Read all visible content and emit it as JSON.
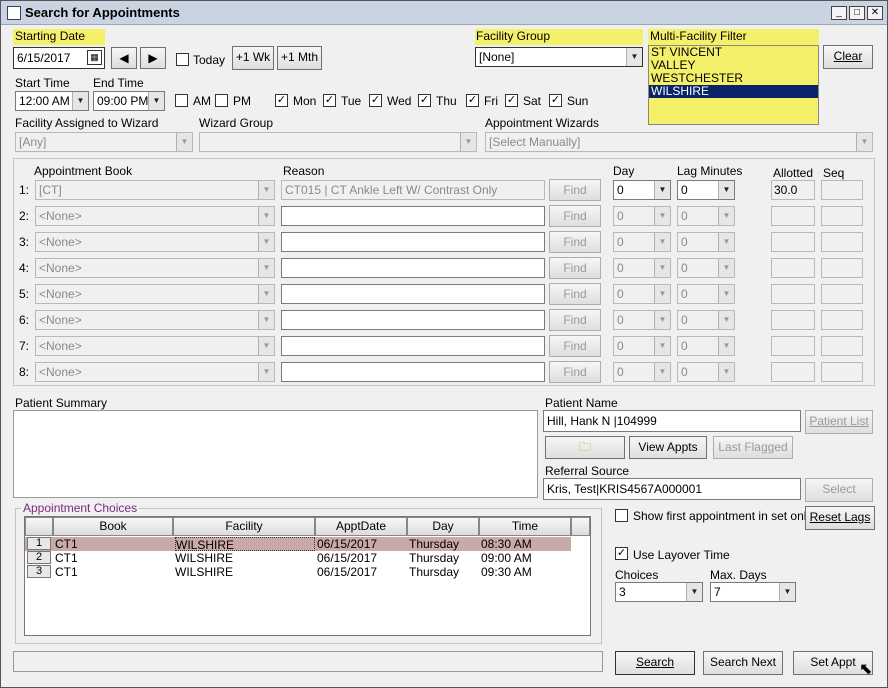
{
  "window": {
    "title": "Search for Appointments",
    "min": "_",
    "max": "□",
    "close": "✕"
  },
  "dates": {
    "starting_label": "Starting Date",
    "starting_value": "6/15/2017",
    "today_label": "Today",
    "plus_wk": "+1 Wk",
    "plus_mth": "+1 Mth",
    "start_time_label": "Start Time",
    "start_time": "12:00 AM",
    "end_time_label": "End Time",
    "end_time": "09:00 PM",
    "am": "AM",
    "pm": "PM"
  },
  "days": [
    {
      "label": "Mon",
      "checked": true
    },
    {
      "label": "Tue",
      "checked": true
    },
    {
      "label": "Wed",
      "checked": true
    },
    {
      "label": "Thu",
      "checked": true
    },
    {
      "label": "Fri",
      "checked": true
    },
    {
      "label": "Sat",
      "checked": true
    },
    {
      "label": "Sun",
      "checked": true
    }
  ],
  "facility_group": {
    "label": "Facility Group",
    "value": "[None]"
  },
  "multi_facility": {
    "label": "Multi-Facility Filter",
    "items": [
      "ST VINCENT",
      "VALLEY",
      "WESTCHESTER",
      "WILSHIRE"
    ],
    "selected": "WILSHIRE",
    "clear": "Clear"
  },
  "wizard": {
    "facility_label": "Facility Assigned to Wizard",
    "facility_value": "[Any]",
    "group_label": "Wizard Group",
    "group_value": "",
    "appt_label": "Appointment Wizards",
    "appt_value": "[Select Manually]"
  },
  "book_headers": {
    "book": "Appointment Book",
    "reason": "Reason",
    "day": "Day",
    "lag": "Lag Minutes",
    "allotted": "Allotted",
    "seq": "Seq"
  },
  "book_rows": [
    {
      "num": "1:",
      "book": "[CT]",
      "reason": "CT015 | CT Ankle Left W/ Contrast Only",
      "find": "Find",
      "day": "0",
      "lag": "0",
      "allotted": "30.0"
    },
    {
      "num": "2:",
      "book": "<None>",
      "reason": "",
      "find": "Find",
      "day": "0",
      "lag": "0",
      "allotted": ""
    },
    {
      "num": "3:",
      "book": "<None>",
      "reason": "",
      "find": "Find",
      "day": "0",
      "lag": "0",
      "allotted": ""
    },
    {
      "num": "4:",
      "book": "<None>",
      "reason": "",
      "find": "Find",
      "day": "0",
      "lag": "0",
      "allotted": ""
    },
    {
      "num": "5:",
      "book": "<None>",
      "reason": "",
      "find": "Find",
      "day": "0",
      "lag": "0",
      "allotted": ""
    },
    {
      "num": "6:",
      "book": "<None>",
      "reason": "",
      "find": "Find",
      "day": "0",
      "lag": "0",
      "allotted": ""
    },
    {
      "num": "7:",
      "book": "<None>",
      "reason": "",
      "find": "Find",
      "day": "0",
      "lag": "0",
      "allotted": ""
    },
    {
      "num": "8:",
      "book": "<None>",
      "reason": "",
      "find": "Find",
      "day": "0",
      "lag": "0",
      "allotted": ""
    }
  ],
  "patient": {
    "summary_label": "Patient Summary",
    "name_label": "Patient Name",
    "name_value": "Hill, Hank N |104999",
    "patient_list": "Patient List",
    "view_appts": "View Appts",
    "last_flagged": "Last Flagged",
    "referral_label": "Referral Source",
    "referral_value": "Kris, Test|KRIS4567A000001",
    "select": "Select"
  },
  "choices": {
    "label": "Appointment Choices",
    "headers": [
      "Book",
      "Facility",
      "ApptDate",
      "Day",
      "Time"
    ],
    "rows": [
      {
        "n": "1",
        "book": "CT1",
        "facility": "WILSHIRE",
        "date": "06/15/2017",
        "day": "Thursday",
        "time": "08:30 AM"
      },
      {
        "n": "2",
        "book": "CT1",
        "facility": "WILSHIRE",
        "date": "06/15/2017",
        "day": "Thursday",
        "time": "09:00 AM"
      },
      {
        "n": "3",
        "book": "CT1",
        "facility": "WILSHIRE",
        "date": "06/15/2017",
        "day": "Thursday",
        "time": "09:30 AM"
      }
    ]
  },
  "options": {
    "show_first": "Show first appointment in set only",
    "reset_lags": "Reset Lags",
    "use_layover": "Use Layover Time",
    "choices_label": "Choices",
    "choices_value": "3",
    "maxdays_label": "Max. Days",
    "maxdays_value": "7"
  },
  "actions": {
    "search": "Search",
    "search_next": "Search Next",
    "set_appt": "Set Appt"
  },
  "colors": {
    "highlight": "#f4f06a",
    "selected": "#0a246a",
    "row_sel": "#c9a9a9"
  }
}
